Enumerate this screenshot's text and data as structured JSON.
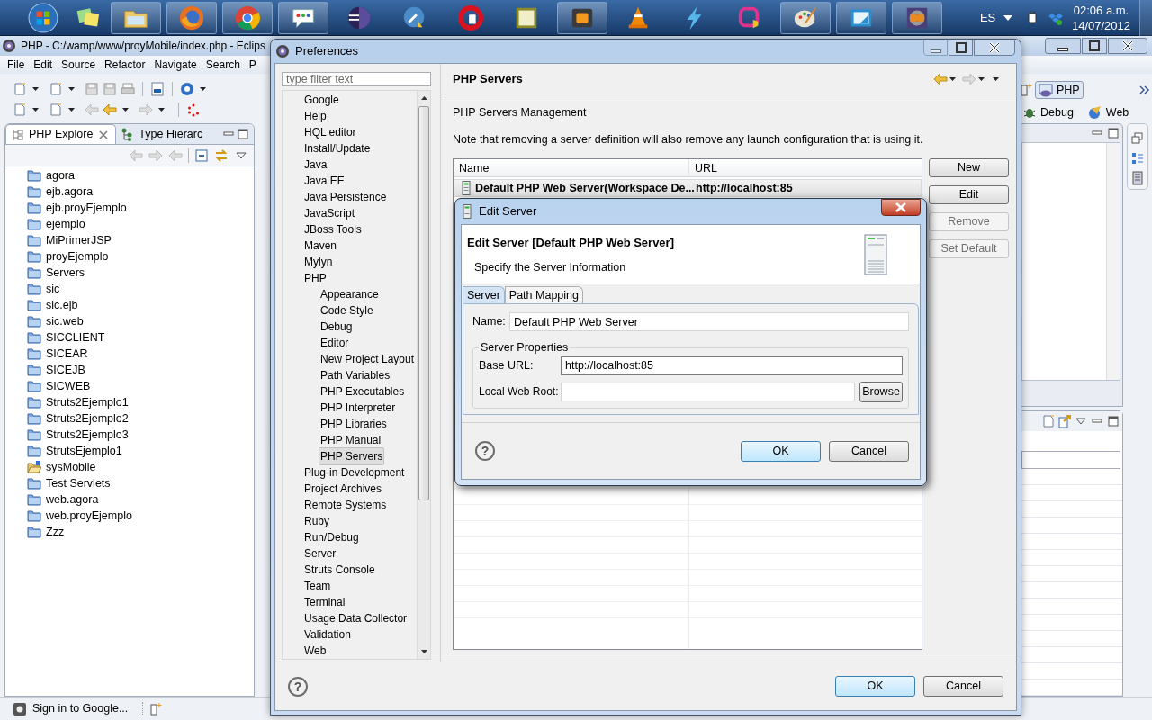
{
  "taskbar": {
    "apps": [
      {
        "kind": "start",
        "running": false
      },
      {
        "kind": "notes",
        "running": false
      },
      {
        "kind": "folder",
        "running": true
      },
      {
        "kind": "firefox",
        "running": true
      },
      {
        "kind": "chrome",
        "running": true
      },
      {
        "kind": "talk",
        "running": true
      },
      {
        "kind": "eclipse",
        "running": false
      },
      {
        "kind": "tools",
        "running": false
      },
      {
        "kind": "opera",
        "running": false
      },
      {
        "kind": "txc",
        "running": false
      },
      {
        "kind": "sublime",
        "running": true
      },
      {
        "kind": "vlc",
        "running": false
      },
      {
        "kind": "bolt",
        "running": false
      },
      {
        "kind": "ulogo",
        "running": false
      },
      {
        "kind": "paint",
        "running": true
      },
      {
        "kind": "remote",
        "running": true
      },
      {
        "kind": "javaee",
        "running": true
      }
    ],
    "language": "ES",
    "time": "02:06 a.m.",
    "date": "14/07/2012"
  },
  "eclipse": {
    "title": "PHP - C:/wamp/www/proyMobile/index.php - Eclips",
    "menu": [
      "File",
      "Edit",
      "Source",
      "Refactor",
      "Navigate",
      "Search",
      "P"
    ],
    "perspectives": [
      {
        "label": "PHP",
        "selected": true
      },
      {
        "label": "Debug",
        "selected": false
      },
      {
        "label": "Web",
        "selected": false
      }
    ],
    "view_tabs": [
      {
        "label": "PHP Explore",
        "selected": true
      },
      {
        "label": "Type Hierarc",
        "selected": false
      }
    ],
    "projects": [
      {
        "label": "agora",
        "kind": "folder"
      },
      {
        "label": "ejb.agora",
        "kind": "folder"
      },
      {
        "label": "ejb.proyEjemplo",
        "kind": "folder"
      },
      {
        "label": "ejemplo",
        "kind": "folder"
      },
      {
        "label": "MiPrimerJSP",
        "kind": "folder"
      },
      {
        "label": "proyEjemplo",
        "kind": "folder"
      },
      {
        "label": "Servers",
        "kind": "folder"
      },
      {
        "label": "sic",
        "kind": "folder"
      },
      {
        "label": "sic.ejb",
        "kind": "folder"
      },
      {
        "label": "sic.web",
        "kind": "folder"
      },
      {
        "label": "SICCLIENT",
        "kind": "folder"
      },
      {
        "label": "SICEAR",
        "kind": "folder"
      },
      {
        "label": "SICEJB",
        "kind": "folder"
      },
      {
        "label": "SICWEB",
        "kind": "folder"
      },
      {
        "label": "Struts2Ejemplo1",
        "kind": "folder"
      },
      {
        "label": "Struts2Ejemplo2",
        "kind": "folder"
      },
      {
        "label": "Struts2Ejemplo3",
        "kind": "folder"
      },
      {
        "label": "StrutsEjemplo1",
        "kind": "folder"
      },
      {
        "label": "sysMobile",
        "kind": "php-project"
      },
      {
        "label": "Test Servlets",
        "kind": "folder"
      },
      {
        "label": "web.agora",
        "kind": "folder"
      },
      {
        "label": "web.proyEjemplo",
        "kind": "folder"
      },
      {
        "label": "Zzz",
        "kind": "folder"
      }
    ],
    "status_bar": "Sign in to Google..."
  },
  "preferences": {
    "title": "Preferences",
    "filter": {
      "placeholder": "type filter text"
    },
    "tree": [
      {
        "label": "Google",
        "selected": false
      },
      {
        "label": "Help",
        "selected": false
      },
      {
        "label": "HQL editor",
        "selected": false
      },
      {
        "label": "Install/Update",
        "selected": false
      },
      {
        "label": "Java",
        "selected": false
      },
      {
        "label": "Java EE",
        "selected": false
      },
      {
        "label": "Java Persistence",
        "selected": false
      },
      {
        "label": "JavaScript",
        "selected": false
      },
      {
        "label": "JBoss Tools",
        "selected": false
      },
      {
        "label": "Maven",
        "selected": false
      },
      {
        "label": "Mylyn",
        "selected": false
      },
      {
        "label": "PHP",
        "selected": false,
        "children": [
          {
            "label": "Appearance",
            "selected": false
          },
          {
            "label": "Code Style",
            "selected": false
          },
          {
            "label": "Debug",
            "selected": false
          },
          {
            "label": "Editor",
            "selected": false
          },
          {
            "label": "New Project Layout",
            "selected": false
          },
          {
            "label": "Path Variables",
            "selected": false
          },
          {
            "label": "PHP Executables",
            "selected": false
          },
          {
            "label": "PHP Interpreter",
            "selected": false
          },
          {
            "label": "PHP Libraries",
            "selected": false
          },
          {
            "label": "PHP Manual",
            "selected": false
          },
          {
            "label": "PHP Servers",
            "selected": true
          }
        ]
      },
      {
        "label": "Plug-in Development",
        "selected": false
      },
      {
        "label": "Project Archives",
        "selected": false
      },
      {
        "label": "Remote Systems",
        "selected": false
      },
      {
        "label": "Ruby",
        "selected": false
      },
      {
        "label": "Run/Debug",
        "selected": false
      },
      {
        "label": "Server",
        "selected": false
      },
      {
        "label": "Struts Console",
        "selected": false
      },
      {
        "label": "Team",
        "selected": false
      },
      {
        "label": "Terminal",
        "selected": false
      },
      {
        "label": "Usage Data Collector",
        "selected": false
      },
      {
        "label": "Validation",
        "selected": false
      },
      {
        "label": "Web",
        "selected": false
      }
    ],
    "heading": "PHP Servers",
    "subtitle": "PHP Servers Management",
    "note": "Note that removing a server definition will also remove any launch configuration that is using it.",
    "table": {
      "columns": [
        "Name",
        "URL"
      ],
      "rows": [
        {
          "name": "Default PHP Web Server(Workspace De...",
          "url": "http://localhost:85",
          "selected": true
        }
      ]
    },
    "buttons": [
      {
        "label": "New",
        "disabled": false
      },
      {
        "label": "Edit",
        "disabled": false
      },
      {
        "label": "Remove",
        "disabled": true
      },
      {
        "label": "Set Default",
        "disabled": true
      }
    ],
    "help": "?",
    "ok": "OK",
    "cancel": "Cancel"
  },
  "edit_server": {
    "title": "Edit Server",
    "heading": "Edit Server [Default PHP Web Server]",
    "description": "Specify the Server Information",
    "tabs": [
      {
        "label": "Server",
        "selected": true
      },
      {
        "label": "Path Mapping",
        "selected": false
      }
    ],
    "name_label": "Name:",
    "name_value": "Default PHP Web Server",
    "group": "Server Properties",
    "base_url_label": "Base URL:",
    "base_url_value": "http://localhost:85",
    "web_root_label": "Local Web Root:",
    "browse": "Browse",
    "help": "?",
    "ok": "OK",
    "cancel": "Cancel"
  }
}
